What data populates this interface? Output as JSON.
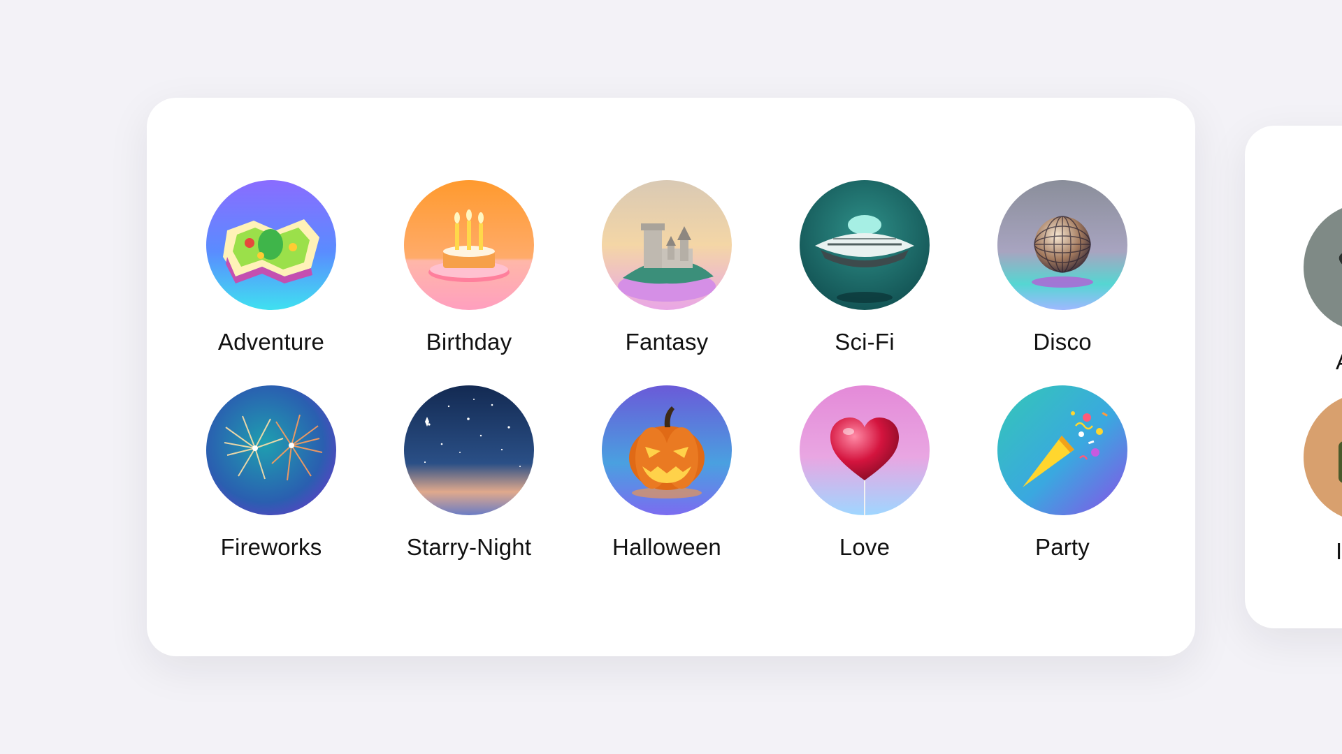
{
  "themes": [
    {
      "label": "Adventure",
      "icon": "map-icon"
    },
    {
      "label": "Birthday",
      "icon": "birthday-cake-icon"
    },
    {
      "label": "Fantasy",
      "icon": "castle-icon"
    },
    {
      "label": "Sci-Fi",
      "icon": "ufo-icon"
    },
    {
      "label": "Disco",
      "icon": "disco-ball-icon"
    },
    {
      "label": "Fireworks",
      "icon": "fireworks-icon"
    },
    {
      "label": "Starry-Night",
      "icon": "starry-sky-icon"
    },
    {
      "label": "Halloween",
      "icon": "pumpkin-icon"
    },
    {
      "label": "Love",
      "icon": "heart-balloon-icon"
    },
    {
      "label": "Party",
      "icon": "party-popper-icon"
    }
  ],
  "peek_card": {
    "icons": [
      "alien-icon",
      "cactus-icon"
    ],
    "partial_labels": [
      "A",
      "I"
    ]
  }
}
